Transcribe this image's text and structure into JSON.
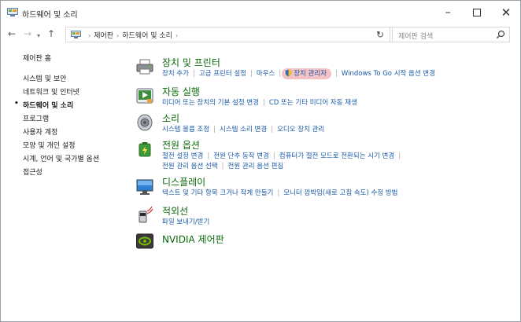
{
  "window": {
    "title": "하드웨어 및 소리",
    "title_icon": "control-panel-icon",
    "controls": {
      "minimize": "–",
      "close": "✕"
    }
  },
  "address": {
    "back": "←",
    "forward": "→",
    "up": "↑",
    "crumbs": [
      "제어판",
      "하드웨어 및 소리"
    ],
    "separator": "›",
    "refresh": "↻",
    "search_placeholder": "제어판 검색"
  },
  "sidebar": {
    "items": [
      {
        "label": "제어판 홈",
        "active": false
      },
      {
        "label": "시스템 및 보안",
        "active": false
      },
      {
        "label": "네트워크 및 인터넷",
        "active": false
      },
      {
        "label": "하드웨어 및 소리",
        "active": true
      },
      {
        "label": "프로그램",
        "active": false
      },
      {
        "label": "사용자 계정",
        "active": false
      },
      {
        "label": "모양 및 개인 설정",
        "active": false
      },
      {
        "label": "시계, 언어 및 국가별 옵션",
        "active": false
      },
      {
        "label": "접근성",
        "active": false
      }
    ],
    "bullet": "•"
  },
  "categories": {
    "devices": {
      "title": "장치 및 프린터",
      "icon": "printer-icon",
      "links": [
        "장치 추가",
        "고급 프린터 설정",
        "마우스",
        "장치 관리자",
        "Windows To Go 시작 옵션 변경"
      ],
      "highlighted": "장치 관리자"
    },
    "autoplay": {
      "title": "자동 실행",
      "icon": "autoplay-icon",
      "links": [
        "미디어 또는 장치의 기본 설정 변경",
        "CD 또는 기타 미디어 자동 재생"
      ]
    },
    "sound": {
      "title": "소리",
      "icon": "speaker-icon",
      "links": [
        "시스템 볼륨 조정",
        "시스템 소리 변경",
        "오디오 장치 관리"
      ]
    },
    "power": {
      "title": "전원 옵션",
      "icon": "battery-icon",
      "links": [
        "절전 설정 변경",
        "전원 단추 동작 변경",
        "컴퓨터가 절전 모드로 전환되는 시기 변경",
        "전원 관리 옵션 선택",
        "전원 관리 옵션 편집"
      ]
    },
    "display": {
      "title": "디스플레이",
      "icon": "monitor-icon",
      "links": [
        "텍스트 및 기타 항목 크거나 작게 만들기",
        "모니터 깜박임(새로 고침 속도) 수정 방법"
      ]
    },
    "pen": {
      "title": "적외선",
      "icon": "infrared-icon",
      "links": [
        "파일 보내기/받기"
      ]
    },
    "nvidia": {
      "title": "NVIDIA 제어판",
      "icon": "nvidia-icon"
    }
  },
  "colors": {
    "category_title": "#0b6a0b",
    "link": "#1a5aa8",
    "highlight": "#f4c1c4"
  }
}
